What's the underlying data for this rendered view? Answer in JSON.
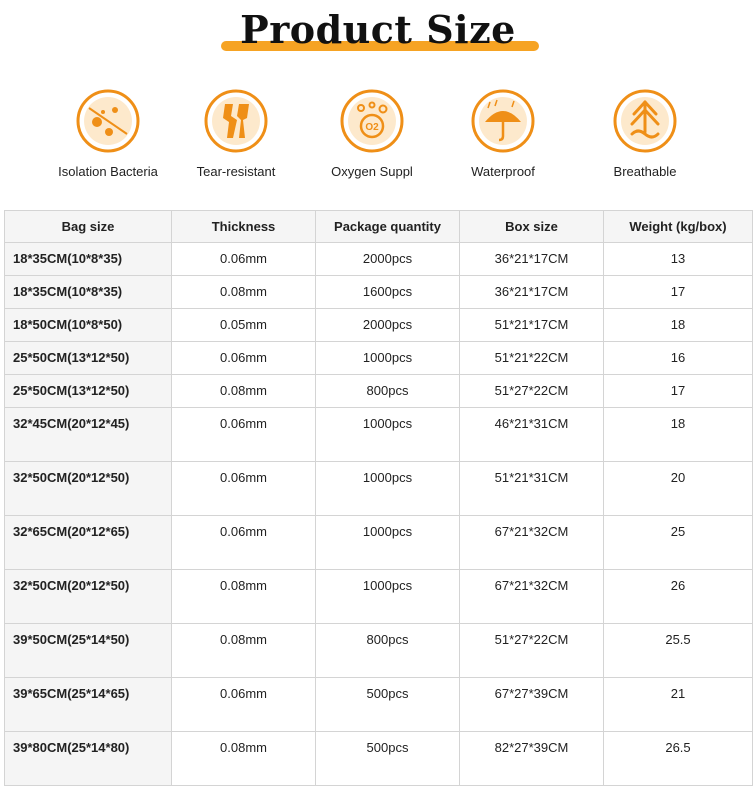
{
  "header": {
    "title": "Product Size",
    "accent_color": "#f6a323"
  },
  "features": [
    {
      "icon": "bacteria-isolation-icon",
      "label": "Isolation Bacteria"
    },
    {
      "icon": "tear-resistant-icon",
      "label": "Tear-resistant"
    },
    {
      "icon": "oxygen-icon",
      "label": "Oxygen Suppl"
    },
    {
      "icon": "umbrella-icon",
      "label": "Waterproof"
    },
    {
      "icon": "breathable-icon",
      "label": "Breathable"
    }
  ],
  "icon_color": "#ef8f17",
  "table": {
    "headers": [
      "Bag size",
      "Thickness",
      "Package quantity",
      "Box size",
      "Weight (kg/box)"
    ],
    "rows": [
      [
        "18*35CM(10*8*35)",
        "0.06mm",
        "2000pcs",
        "36*21*17CM",
        "13"
      ],
      [
        "18*35CM(10*8*35)",
        "0.08mm",
        "1600pcs",
        "36*21*17CM",
        "17"
      ],
      [
        "18*50CM(10*8*50)",
        "0.05mm",
        "2000pcs",
        "51*21*17CM",
        "18"
      ],
      [
        "25*50CM(13*12*50)",
        "0.06mm",
        "1000pcs",
        "51*21*22CM",
        "16"
      ],
      [
        "25*50CM(13*12*50)",
        "0.08mm",
        "800pcs",
        "51*27*22CM",
        "17"
      ],
      [
        "32*45CM(20*12*45)",
        "0.06mm",
        "1000pcs",
        "46*21*31CM",
        "18"
      ],
      [
        "32*50CM(20*12*50)",
        "0.06mm",
        "1000pcs",
        "51*21*31CM",
        "20"
      ],
      [
        "32*65CM(20*12*65)",
        "0.06mm",
        "1000pcs",
        "67*21*32CM",
        "25"
      ],
      [
        "32*50CM(20*12*50)",
        "0.08mm",
        "1000pcs",
        "67*21*32CM",
        "26"
      ],
      [
        "39*50CM(25*14*50)",
        "0.08mm",
        "800pcs",
        "51*27*22CM",
        "25.5"
      ],
      [
        "39*65CM(25*14*65)",
        "0.06mm",
        "500pcs",
        "67*27*39CM",
        "21"
      ],
      [
        "39*80CM(25*14*80)",
        "0.08mm",
        "500pcs",
        "82*27*39CM",
        "26.5"
      ]
    ]
  }
}
